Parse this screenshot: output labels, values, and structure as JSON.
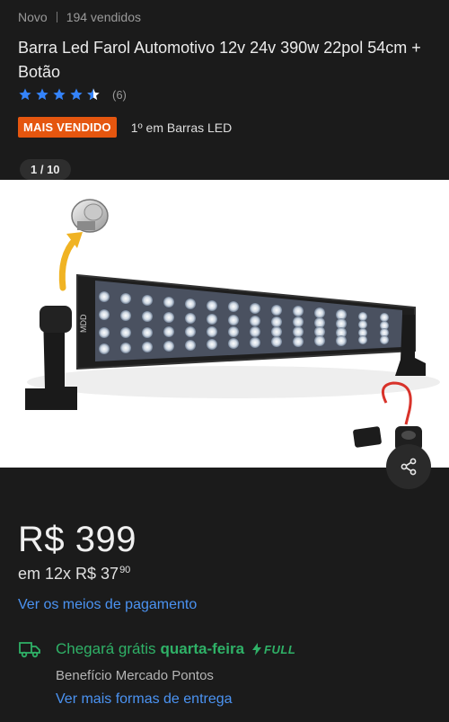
{
  "meta": {
    "condition": "Novo",
    "sold": "194 vendidos"
  },
  "product": {
    "title": "Barra Led Farol Automotivo 12v 24v 390w 22pol 54cm + Botão"
  },
  "rating": {
    "stars": 4.5,
    "count": "(6)",
    "color": "#3483fa"
  },
  "badge": {
    "label": "MAIS VENDIDO",
    "color": "#e5560f"
  },
  "rank": {
    "text": "1º em Barras LED"
  },
  "gallery": {
    "counter": "1 / 10",
    "share_icon": "share-icon",
    "brand_text": "MDD"
  },
  "price": {
    "main": "R$ 399",
    "installments_prefix": "em 12x R$ 37",
    "installments_cents": "90"
  },
  "links": {
    "payment": "Ver os meios de pagamento",
    "shipping": "Ver mais formas de entrega"
  },
  "shipping": {
    "prefix": "Chegará grátis",
    "day": "quarta-feira",
    "full": "FULL",
    "benefit": "Benefício Mercado Pontos",
    "icon": "truck-icon",
    "color": "#2fb167"
  }
}
